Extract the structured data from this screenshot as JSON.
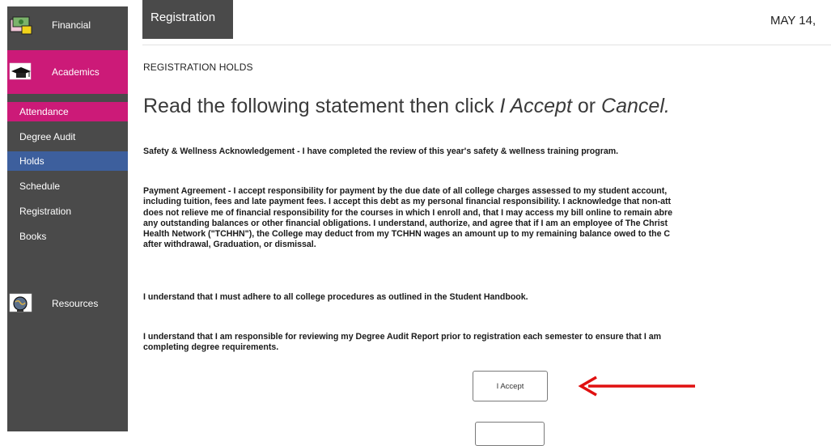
{
  "sidebar": {
    "sections": {
      "financial": {
        "label": "Financial",
        "icon": "money-icon"
      },
      "academics": {
        "label": "Academics",
        "icon": "graduation-cap-icon"
      },
      "resources": {
        "label": "Resources",
        "icon": "globe-icon"
      }
    },
    "items": [
      {
        "label": "Attendance",
        "state": "highlight-pink"
      },
      {
        "label": "Degree Audit",
        "state": "normal"
      },
      {
        "label": "Holds",
        "state": "selected"
      },
      {
        "label": "Schedule",
        "state": "normal"
      },
      {
        "label": "Registration",
        "state": "normal"
      },
      {
        "label": "Books",
        "state": "normal"
      }
    ]
  },
  "header": {
    "tab_label": "Registration",
    "date": "MAY 14,"
  },
  "page": {
    "label": "REGISTRATION HOLDS",
    "heading_prefix": "Read the following statement then click ",
    "heading_accept": "I Accept",
    "heading_or": " or ",
    "heading_cancel": "Cancel.",
    "paragraphs": {
      "safety": "Safety & Wellness Acknowledgement - I have completed the review of this year's safety & wellness training program.",
      "payment_lines": [
        "Payment Agreement - I accept responsibility for payment by the due date of all college charges assessed to my student account,",
        "including tuition, fees and late payment fees. I accept this debt as my personal financial responsibility. I acknowledge that non-att",
        "does not relieve me of financial responsibility for the courses in which I enroll and, that I may access my bill online to remain abre",
        "any outstanding balances or other financial obligations. I understand, authorize, and agree that if I am an employee of The Christ",
        "Health Network (\"TCHHN\"), the College may deduct from my TCHHN wages an amount up to my remaining balance owed to the C",
        "after withdrawal, Graduation, or dismissal."
      ],
      "handbook": "I understand that I must adhere to all college procedures as outlined in the Student Handbook.",
      "degree_audit_lines": [
        "I understand that I am responsible for reviewing my Degree Audit Report prior to registration each semester to ensure that I am",
        "completing degree requirements."
      ]
    },
    "accept_button": "I Accept"
  },
  "colors": {
    "sidebar_bg": "#4a4a4a",
    "academics_pink": "#cc1a78",
    "holds_blue": "#3d5f9d",
    "arrow_red": "#e01010"
  }
}
